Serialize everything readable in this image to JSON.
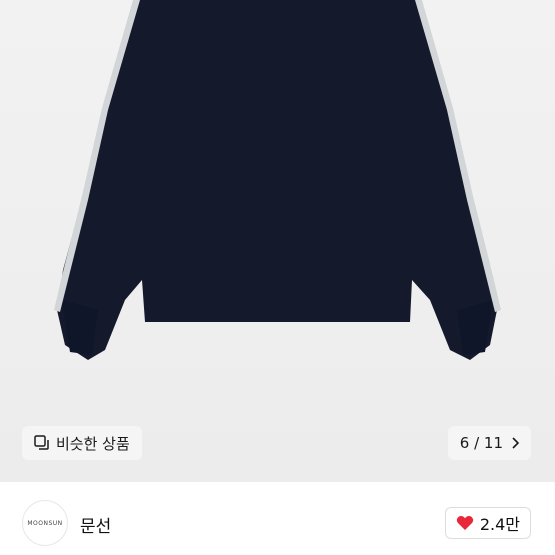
{
  "product_image": {
    "description_icon": "navy-sweater-image"
  },
  "similar": {
    "label": "비슷한 상품",
    "icon": "similar-items-icon"
  },
  "pagination": {
    "text": "6 / 11",
    "icon": "chevron-right-icon"
  },
  "seller": {
    "avatar_text": "MOONSUN",
    "name": "문선"
  },
  "like": {
    "count": "2.4만",
    "icon": "heart-icon",
    "color": "#e8283a"
  },
  "colors": {
    "sweater": "#141a2c",
    "trim": "#cfd3d6"
  }
}
